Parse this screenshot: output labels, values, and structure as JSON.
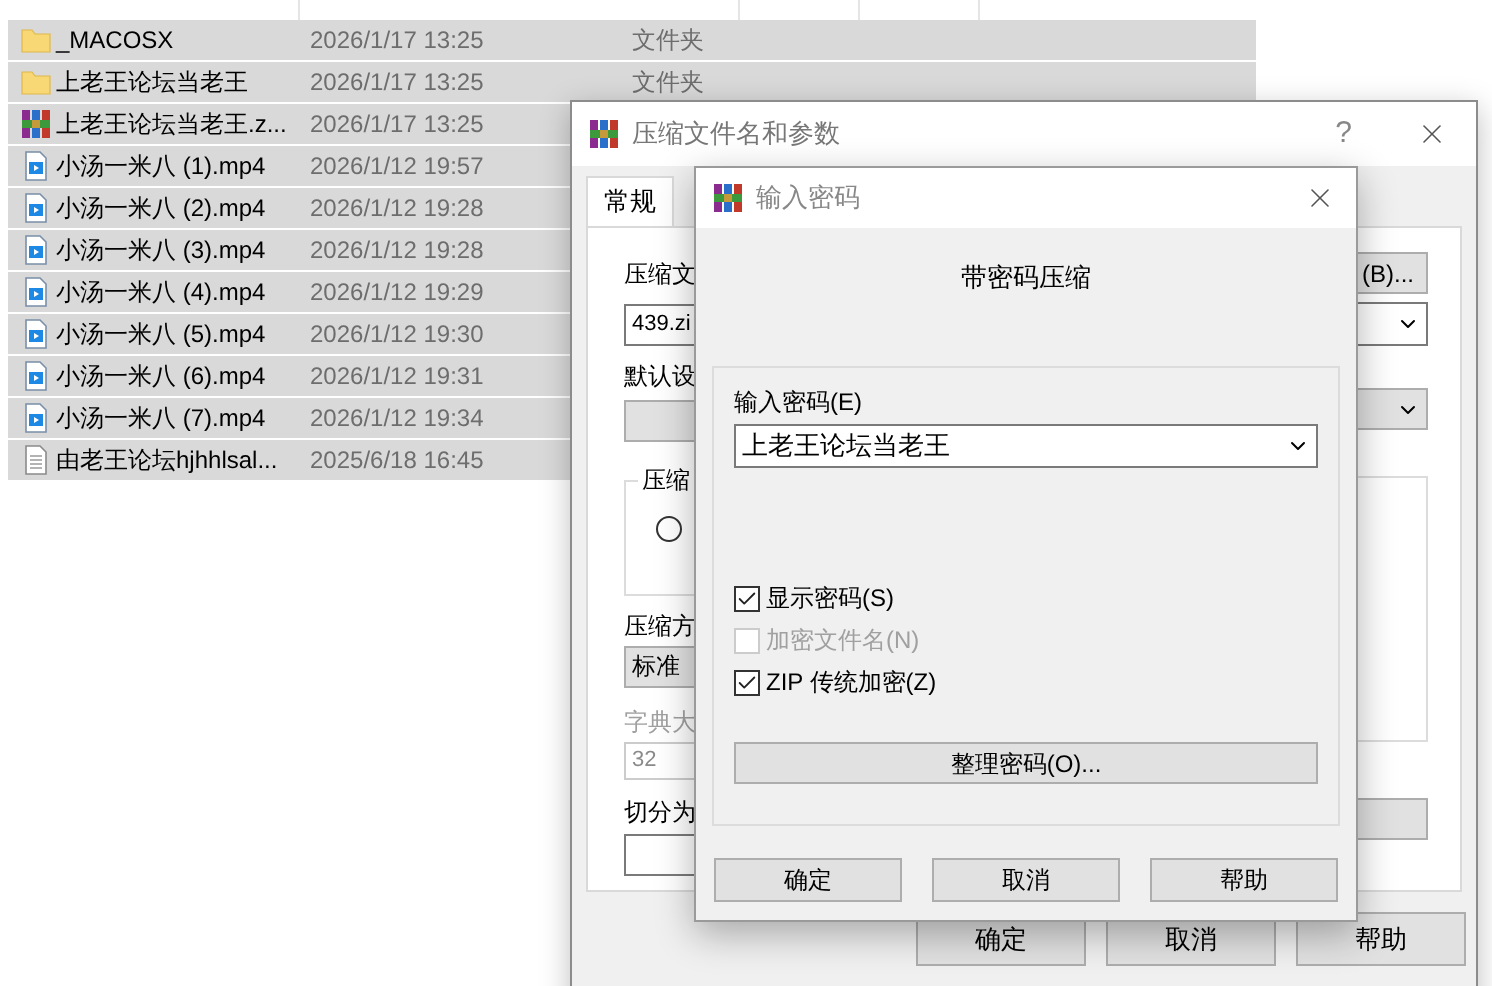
{
  "files": [
    {
      "kind": "folder",
      "name": "_MACOSX",
      "date": "2026/1/17 13:25",
      "type": "文件夹",
      "selected": true
    },
    {
      "kind": "folder",
      "name": "上老王论坛当老王",
      "date": "2026/1/17 13:25",
      "type": "文件夹",
      "selected": true
    },
    {
      "kind": "archive",
      "name": "上老王论坛当老王.z...",
      "date": "2026/1/17 13:25",
      "selected": true
    },
    {
      "kind": "video",
      "name": "小汤一米八 (1).mp4",
      "date": "2026/1/12 19:57",
      "selected": true
    },
    {
      "kind": "video",
      "name": "小汤一米八 (2).mp4",
      "date": "2026/1/12 19:28",
      "selected": true
    },
    {
      "kind": "video",
      "name": "小汤一米八 (3).mp4",
      "date": "2026/1/12 19:28",
      "selected": true
    },
    {
      "kind": "video",
      "name": "小汤一米八 (4).mp4",
      "date": "2026/1/12 19:29",
      "selected": true
    },
    {
      "kind": "video",
      "name": "小汤一米八 (5).mp4",
      "date": "2026/1/12 19:30",
      "selected": true
    },
    {
      "kind": "video",
      "name": "小汤一米八 (6).mp4",
      "date": "2026/1/12 19:31",
      "selected": true
    },
    {
      "kind": "video",
      "name": "小汤一米八 (7).mp4",
      "date": "2026/1/12 19:34",
      "selected": true
    },
    {
      "kind": "text",
      "name": "由老王论坛hjhhlsal...",
      "date": "2025/6/18 16:45",
      "selected": true
    }
  ],
  "archive_dialog": {
    "title": "压缩文件名和参数",
    "help": "?",
    "tabs": [
      {
        "label": "常规",
        "selected": true
      }
    ],
    "archive_name_label": "压缩文",
    "archive_name": "439.zi",
    "browse_button": "(B)...",
    "profile_label": "默认设",
    "format_group_label": "压缩",
    "format_radio": {
      "selected": false
    },
    "method_label": "压缩方",
    "method": "标准",
    "dict_label": "字典大",
    "dict": "32",
    "split_label": "切分为",
    "buttons": [
      "确定",
      "取消",
      "帮助"
    ]
  },
  "password_dialog": {
    "title": "输入密码",
    "heading": "带密码压缩",
    "password_label": "输入密码(E)",
    "password": "上老王论坛当老王",
    "options": [
      {
        "label": "显示密码(S)",
        "checked": true,
        "disabled": false
      },
      {
        "label": "加密文件名(N)",
        "checked": false,
        "disabled": true
      },
      {
        "label": "ZIP 传统加密(Z)",
        "checked": true,
        "disabled": false
      }
    ],
    "organize_button": "整理密码(O)...",
    "buttons": [
      "确定",
      "取消",
      "帮助"
    ]
  }
}
